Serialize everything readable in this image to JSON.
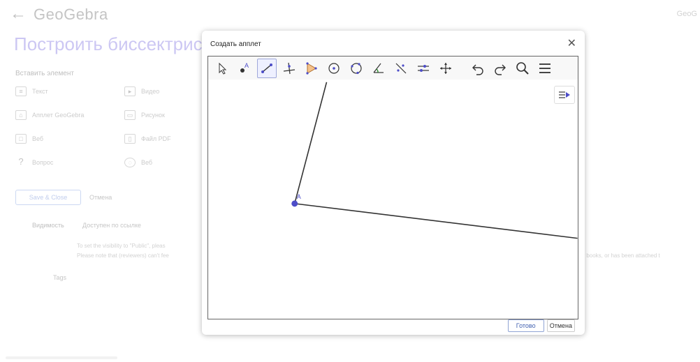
{
  "header": {
    "brand": "GeoGebra",
    "top_right": "GeoG"
  },
  "page": {
    "title": "Построить биссектрис",
    "insert_label": "Вставить элемент",
    "elements": [
      {
        "label": "Текст",
        "icon": "text-icon"
      },
      {
        "label": "Видео",
        "icon": "video-icon"
      },
      {
        "label": "Апплет GeoGebra",
        "icon": "geogebra-icon"
      },
      {
        "label": "Рисунок",
        "icon": "image-icon"
      },
      {
        "label": "Веб",
        "icon": "web-icon"
      },
      {
        "label": "Файл PDF",
        "icon": "pdf-icon"
      },
      {
        "label": "Вопрос",
        "icon": "question-icon"
      },
      {
        "label": "Веб",
        "icon": "web-icon"
      }
    ],
    "save_draft": "Save & Close",
    "cancel": "Отмена",
    "visibility_label": "Видимость",
    "visibility_value": "Доступен по ссылке",
    "visibility_note1": "To set the visibility to \"Public\", pleas",
    "visibility_note2": "Please note that (reviewers) can't fee",
    "visibility_note_right": "or books, or has been attached t",
    "tags_label": "Tags"
  },
  "modal": {
    "title": "Создать апплет",
    "ready_button": "Готово",
    "cancel_button": "Отмена",
    "point_label": "A",
    "tools": [
      {
        "name": "move-tool-icon"
      },
      {
        "name": "point-tool-icon"
      },
      {
        "name": "segment-tool-icon",
        "active": true
      },
      {
        "name": "perpendicular-tool-icon"
      },
      {
        "name": "polygon-tool-icon"
      },
      {
        "name": "circle-tool-icon"
      },
      {
        "name": "circle-three-points-tool-icon"
      },
      {
        "name": "angle-tool-icon"
      },
      {
        "name": "reflect-tool-icon"
      },
      {
        "name": "slider-tool-icon"
      },
      {
        "name": "move-graphics-tool-icon"
      },
      {
        "name": "undo-icon"
      },
      {
        "name": "redo-icon"
      },
      {
        "name": "search-icon"
      },
      {
        "name": "menu-icon"
      }
    ]
  },
  "colors": {
    "accent": "#7b6ee0",
    "point": "#4d4dc8",
    "active_tool": "#9fa8da"
  }
}
